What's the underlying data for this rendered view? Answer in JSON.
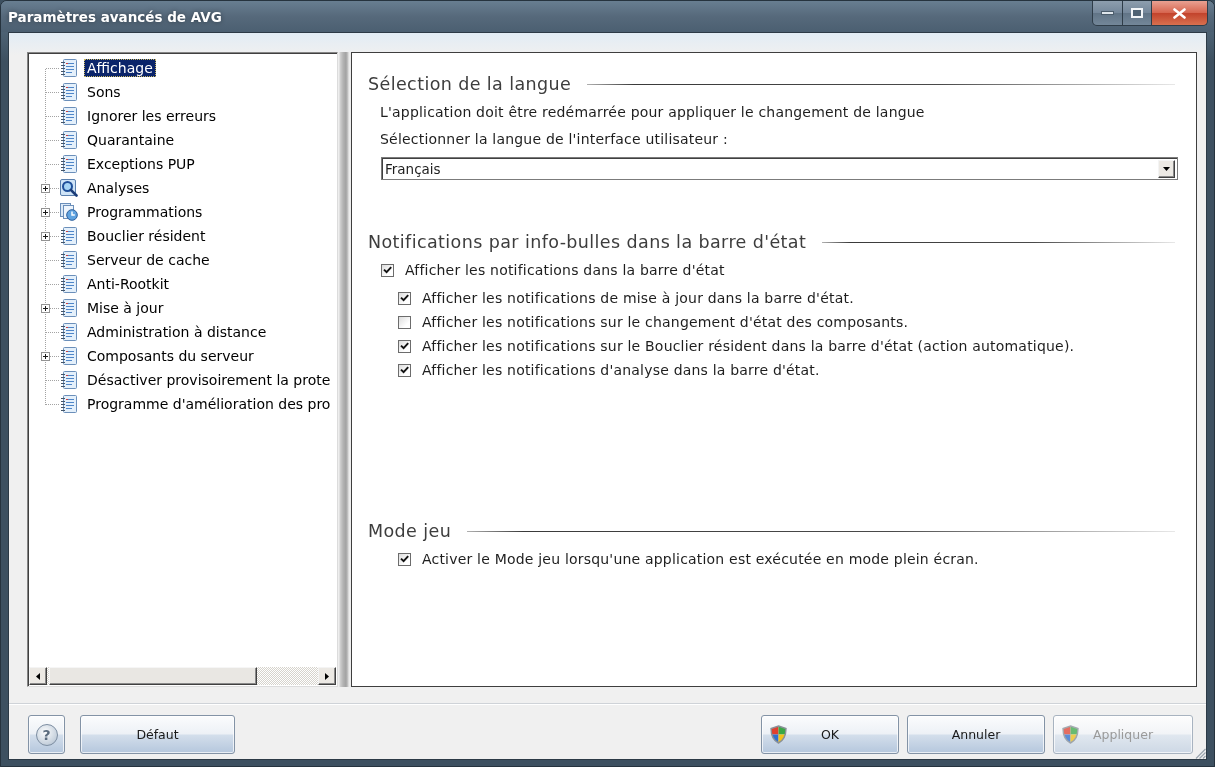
{
  "window": {
    "title": "Paramètres avancés de AVG"
  },
  "tree": {
    "items": [
      {
        "label": "Affichage",
        "kind": "page",
        "expandable": false,
        "selected": true
      },
      {
        "label": "Sons",
        "kind": "page",
        "expandable": false,
        "selected": false
      },
      {
        "label": "Ignorer les erreurs",
        "kind": "page",
        "expandable": false,
        "selected": false
      },
      {
        "label": "Quarantaine",
        "kind": "page",
        "expandable": false,
        "selected": false
      },
      {
        "label": "Exceptions PUP",
        "kind": "page",
        "expandable": false,
        "selected": false
      },
      {
        "label": "Analyses",
        "kind": "scan",
        "expandable": true,
        "expanded": false,
        "selected": false
      },
      {
        "label": "Programmations",
        "kind": "schedule",
        "expandable": true,
        "expanded": false,
        "selected": false
      },
      {
        "label": "Bouclier résident",
        "kind": "page",
        "expandable": true,
        "expanded": false,
        "selected": false
      },
      {
        "label": "Serveur de cache",
        "kind": "page",
        "expandable": false,
        "selected": false
      },
      {
        "label": "Anti-Rootkit",
        "kind": "page",
        "expandable": false,
        "selected": false
      },
      {
        "label": "Mise à jour",
        "kind": "page",
        "expandable": true,
        "expanded": false,
        "selected": false
      },
      {
        "label": "Administration à distance",
        "kind": "page",
        "expandable": false,
        "selected": false
      },
      {
        "label": "Composants du serveur",
        "kind": "page",
        "expandable": true,
        "expanded": false,
        "selected": false
      },
      {
        "label": "Désactiver provisoirement la prote",
        "kind": "page",
        "expandable": false,
        "selected": false
      },
      {
        "label": "Programme d'amélioration des pro",
        "kind": "page",
        "expandable": false,
        "selected": false
      }
    ]
  },
  "sections": [
    {
      "title": "Sélection de la langue",
      "items": [
        {
          "kind": "text",
          "text": "L'application doit être redémarrée pour appliquer le changement de langue"
        },
        {
          "kind": "text",
          "text": "Sélectionner la langue de l'interface utilisateur :"
        },
        {
          "kind": "select",
          "value": "Français"
        }
      ]
    },
    {
      "title": "Notifications par info-bulles dans la barre d'état",
      "items": [
        {
          "kind": "checkbox",
          "label": "Afficher les notifications dans la barre d'état",
          "checked": true,
          "children": [
            {
              "label": "Afficher les notifications de mise à jour dans la barre d'état.",
              "checked": true
            },
            {
              "label": "Afficher les notifications sur le changement d'état des composants.",
              "checked": false
            },
            {
              "label": "Afficher les notifications sur le Bouclier résident dans la barre d'état (action automatique).",
              "checked": true
            },
            {
              "label": "Afficher les notifications d'analyse dans la barre d'état.",
              "checked": true
            }
          ]
        }
      ]
    },
    {
      "title": "Mode jeu",
      "items": [
        {
          "kind": "checkbox",
          "label": "Activer le Mode jeu lorsqu'une application est exécutée en mode plein écran.",
          "checked": true
        }
      ]
    }
  ],
  "footer": {
    "left_buttons": [
      {
        "kind": "help",
        "label": "?",
        "disabled": false
      },
      {
        "kind": "plain",
        "label": "Défaut",
        "disabled": false
      }
    ],
    "right_buttons": [
      {
        "kind": "shield",
        "label": "OK",
        "disabled": false
      },
      {
        "kind": "plain",
        "label": "Annuler",
        "disabled": false
      },
      {
        "kind": "shield",
        "label": "Appliquer",
        "disabled": true
      }
    ]
  }
}
